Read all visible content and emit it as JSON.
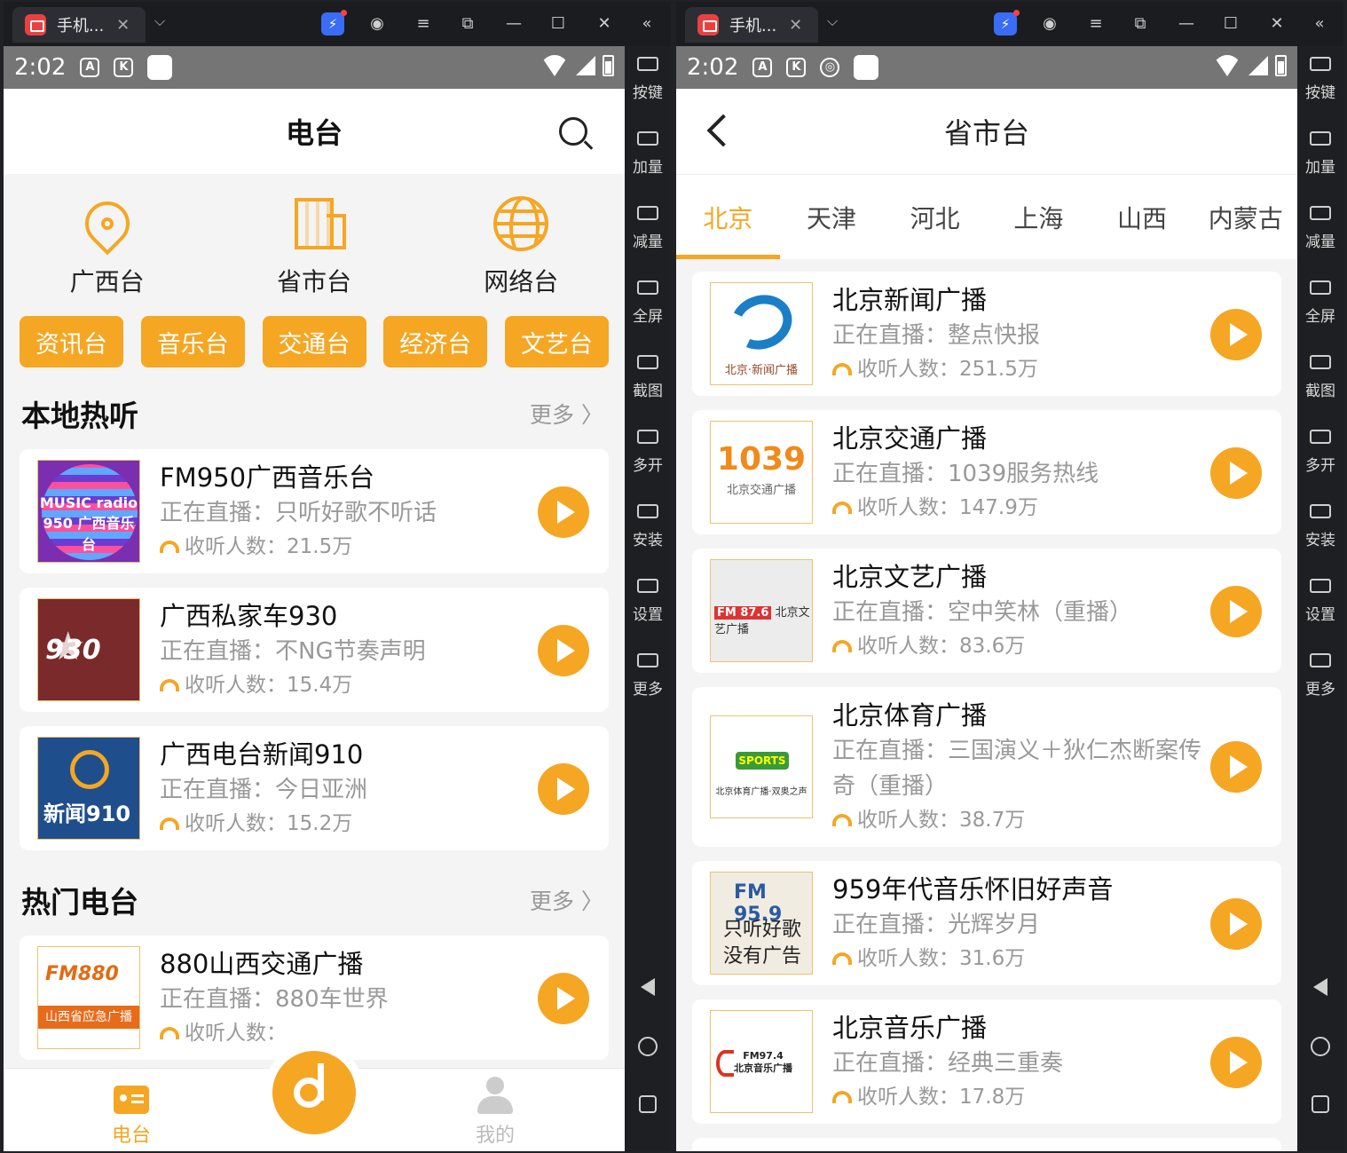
{
  "window_left": {
    "tab_title": "手机...",
    "status_time": "2:02"
  },
  "window_right": {
    "tab_title": "手机...",
    "status_time": "2:02"
  },
  "sidebar_tools": [
    "按键",
    "加量",
    "减量",
    "全屏",
    "截图",
    "多开",
    "安装",
    "设置",
    "更多"
  ],
  "left": {
    "title": "电台",
    "categories": [
      {
        "label": "广西台",
        "icon": "location-pin-icon"
      },
      {
        "label": "省市台",
        "icon": "building-icon"
      },
      {
        "label": "网络台",
        "icon": "globe-icon"
      }
    ],
    "chips": [
      "资讯台",
      "音乐台",
      "交通台",
      "经济台",
      "文艺台"
    ],
    "local_hot": {
      "title": "本地热听",
      "more": "更多 〉",
      "items": [
        {
          "name": "FM950广西音乐台",
          "now": "正在直播：只听好歌不听话",
          "listeners": "收听人数：21.5万",
          "logo_text": "MUSIC radio 950 广西音乐台"
        },
        {
          "name": "广西私家车930",
          "now": "正在直播：不NG节奏声明",
          "listeners": "收听人数：15.4万",
          "logo_text": "930"
        },
        {
          "name": "广西电台新闻910",
          "now": "正在直播：今日亚洲",
          "listeners": "收听人数：15.2万",
          "logo_text": "新闻910"
        }
      ]
    },
    "hot_radio": {
      "title": "热门电台",
      "more": "更多 〉",
      "items": [
        {
          "name": "880山西交通广播",
          "now": "正在直播：880车世界",
          "listeners": "收听人数：",
          "logo_top": "FM880",
          "logo_bar": "山西省应急广播"
        }
      ]
    },
    "nav": {
      "radio": "电台",
      "mine": "我的"
    }
  },
  "right": {
    "title": "省市台",
    "tabs": [
      "北京",
      "天津",
      "河北",
      "上海",
      "山西",
      "内蒙古"
    ],
    "items": [
      {
        "name": "北京新闻广播",
        "now": "正在直播：整点快报",
        "listeners": "收听人数：251.5万",
        "logo_text": "北京·新闻广播"
      },
      {
        "name": "北京交通广播",
        "now": "正在直播：1039服务热线",
        "listeners": "收听人数：147.9万",
        "logo_big": "1039",
        "logo_small": "北京交通广播"
      },
      {
        "name": "北京文艺广播",
        "now": "正在直播：空中笑林（重播）",
        "listeners": "收听人数：83.6万",
        "logo_tag": "FM 87.6",
        "logo_text": "北京文艺广播"
      },
      {
        "name": "北京体育广播",
        "now": "正在直播：三国演义＋狄仁杰断案传奇（重播）",
        "listeners": "收听人数：38.7万",
        "logo_tag": "SPORTS",
        "logo_text": "北京体育广播·双奥之声"
      },
      {
        "name": "959年代音乐怀旧好声音",
        "now": "正在直播：光辉岁月",
        "listeners": "收听人数：31.6万",
        "logo_top": "FM 95.9",
        "logo_text": "只听好歌\n没有广告"
      },
      {
        "name": "北京音乐广播",
        "now": "正在直播：经典三重奏",
        "listeners": "收听人数：17.8万",
        "logo_text": "FM97.4\n北京音乐广播"
      }
    ]
  },
  "colors": {
    "accent": "#f5a623",
    "status_bar": "#757575",
    "toolbar_bg": "#1e1f22"
  }
}
